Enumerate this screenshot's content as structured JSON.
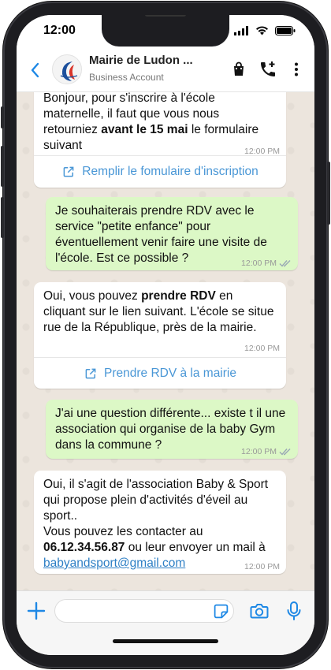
{
  "status_bar": {
    "time": "12:00"
  },
  "header": {
    "contact_name": "Mairie de Ludon ...",
    "contact_subtitle": "Business Account",
    "icons": [
      "back-arrow-icon",
      "shopping-bag-icon",
      "add-call-icon",
      "more-vert-icon"
    ]
  },
  "messages": [
    {
      "direction": "in",
      "parts": [
        {
          "text": "Bonjour, pour s'inscrire à l'école maternelle, il faut que vous nous retourniez ",
          "bold": false
        },
        {
          "text": "avant le 15 mai",
          "bold": true
        },
        {
          "text": " le formulaire suivant",
          "bold": false
        }
      ],
      "time": "12:00 PM",
      "button": "Remplir le fomulaire d'inscription"
    },
    {
      "direction": "out",
      "parts": [
        {
          "text": "Je souhaiterais prendre RDV avec le service \"petite enfance\" pour éventuellement venir faire une visite de l'école. Est ce possible ?",
          "bold": false
        }
      ],
      "time": "12:00 PM"
    },
    {
      "direction": "in",
      "parts": [
        {
          "text": "Oui, vous pouvez ",
          "bold": false
        },
        {
          "text": "prendre RDV",
          "bold": true
        },
        {
          "text": " en cliquant sur le lien suivant. L'école se situe rue de la République, près de la mairie.",
          "bold": false
        }
      ],
      "time": "12:00 PM",
      "button": "Prendre RDV à la mairie"
    },
    {
      "direction": "out",
      "parts": [
        {
          "text": "J'ai une question différente... existe t il une association qui organise de la baby Gym dans la commune ?",
          "bold": false
        }
      ],
      "time": "12:00 PM"
    },
    {
      "direction": "in",
      "parts": [
        {
          "text": "Oui, il s'agit de l'association Baby & Sport qui propose plein d'activités d'éveil au sport..",
          "bold": false
        },
        {
          "text": "Vous pouvez les contacter au",
          "bold": false
        },
        {
          "text": "06.12.34.56.87",
          "bold": true
        },
        {
          "text": " ou leur envoyer un mail à",
          "bold": false
        },
        {
          "text": "babyandsport@gmail.com",
          "bold": false,
          "link": true
        }
      ],
      "time": "12:00 PM"
    }
  ],
  "composer": {
    "placeholder": "",
    "icons": [
      "plus-icon",
      "sticker-icon",
      "camera-icon",
      "microphone-icon"
    ]
  },
  "colors": {
    "chat_background": "#ece5dd",
    "outgoing_bubble": "#dcf8c6",
    "incoming_bubble": "#ffffff",
    "accent_blue": "#1e88e5",
    "link_blue": "#4a97d6",
    "read_tick": "#9aa8b5"
  }
}
